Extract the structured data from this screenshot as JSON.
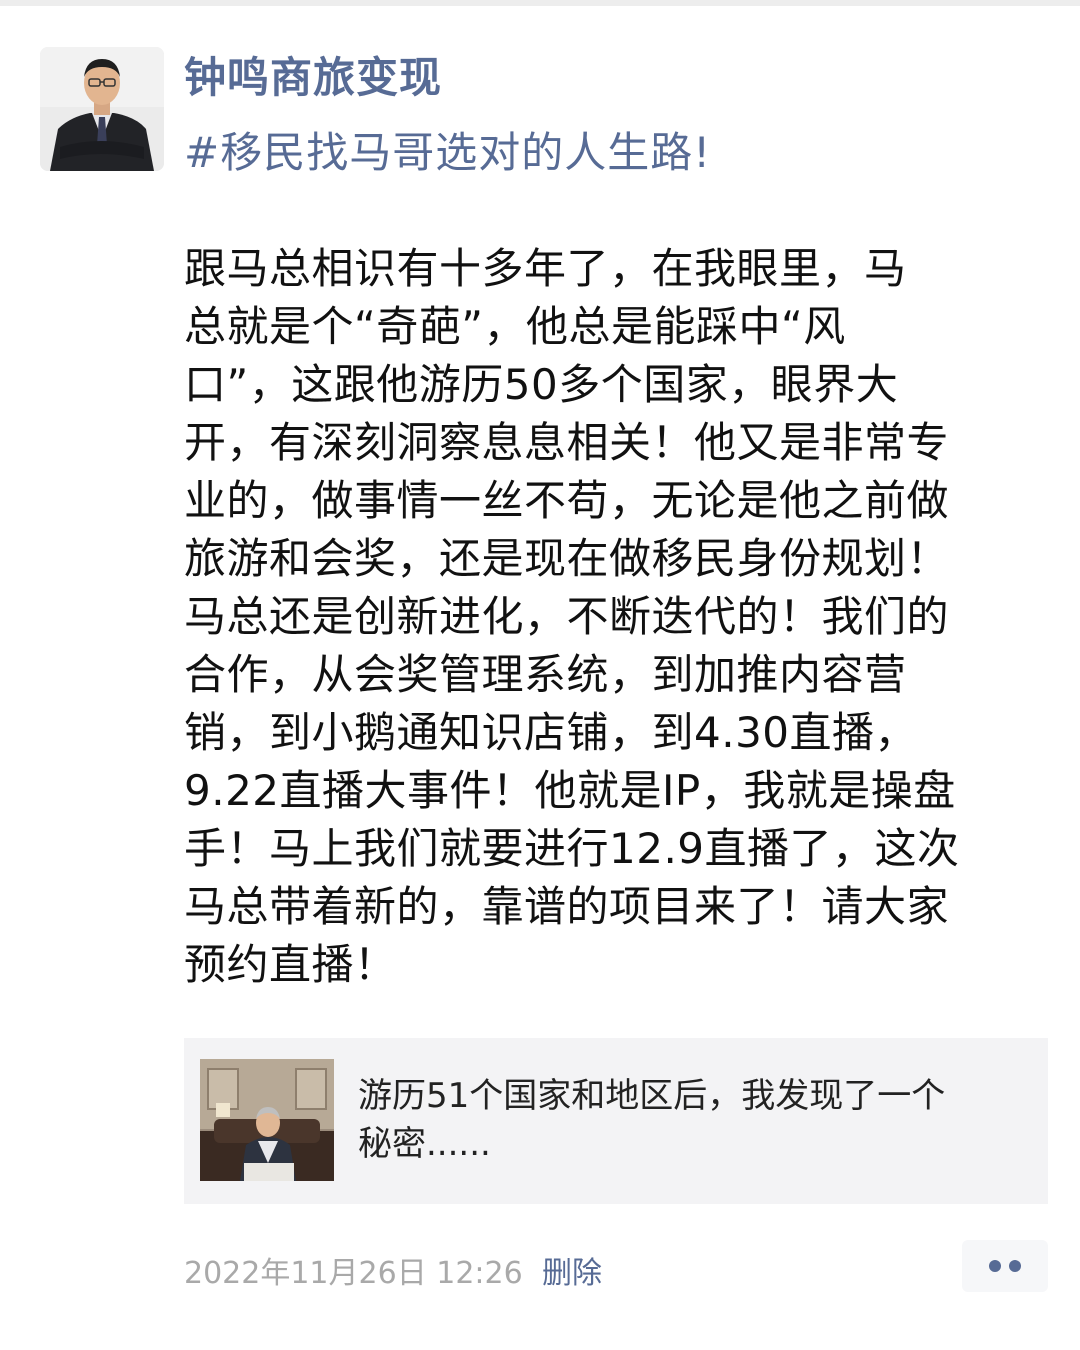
{
  "post": {
    "author_name": "钟鸣商旅变现",
    "topic_tag": "#移民找马哥选对的人生路!",
    "body_lines": [
      "跟马总相识有十多年了，在我眼里，马",
      "总就是个“奇葩”，他总是能踩中“风",
      "口”，这跟他游历50多个国家，眼界大",
      "开，有深刻洞察息息相关！他又是非常专",
      "业的，做事情一丝不苟，无论是他之前做",
      "旅游和会奖，还是现在做移民身份规划！",
      "马总还是创新进化，不断迭代的！我们的",
      "合作，从会奖管理系统，到加推内容营",
      "销，到小鹅通知识店铺，到4.30直播，",
      "9.22直播大事件！他就是IP，我就是操盘",
      "手！马上我们就要进行12.9直播了，这次",
      "马总带着新的，靠谱的项目来了！请大家",
      "预约直播！"
    ],
    "body_text": "跟马总相识有十多年了，在我眼里，马\n总就是个“奇葩”，他总是能踩中“风\n口”，这跟他游历50多个国家，眼界大\n开，有深刻洞察息息相关！他又是非常专\n业的，做事情一丝不苟，无论是他之前做\n旅游和会奖，还是现在做移民身份规划！\n马总还是创新进化，不断迭代的！我们的\n合作，从会奖管理系统，到加推内容营\n销，到小鹅通知识店铺，到4.30直播，\n9.22直播大事件！他就是IP，我就是操盘\n手！马上我们就要进行12.9直播了，这次\n马总带着新的，靠谱的项目来了！请大家\n预约直播！",
    "shared_link": {
      "title": "游历51个国家和地区后，我发现了一个\n秘密......"
    },
    "timestamp": "2022年11月26日 12:26",
    "delete_label": "删除"
  },
  "icons": {
    "avatar": "person-in-suit-photo",
    "link_thumbnail": "man-seated-on-sofa-photo",
    "more": "more-dots-icon"
  },
  "colors": {
    "link_blue": "#576b95",
    "text_primary": "#111111",
    "text_secondary": "#a9a9a9",
    "card_background": "#f3f3f5"
  }
}
